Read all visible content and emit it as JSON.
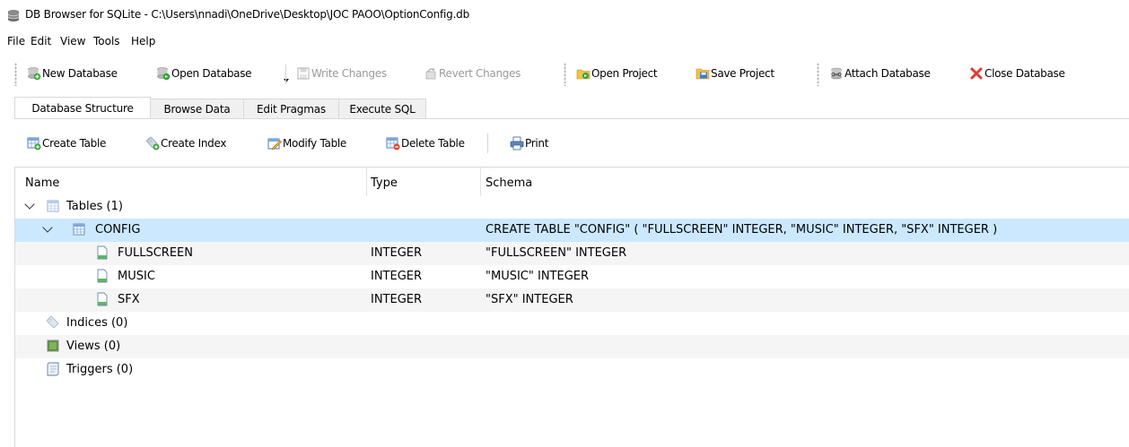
{
  "window": {
    "title": "DB Browser for SQLite - C:\\Users\\nnadi\\OneDrive\\Desktop\\JOC PAOO\\OptionConfig.db"
  },
  "menu": [
    "File",
    "Edit",
    "View",
    "Tools",
    "Help"
  ],
  "toolbar": {
    "new_database": "New Database",
    "open_database": "Open Database",
    "write_changes": "Write Changes",
    "revert_changes": "Revert Changes",
    "open_project": "Open Project",
    "save_project": "Save Project",
    "attach_database": "Attach Database",
    "close_database": "Close Database"
  },
  "tabs": [
    "Database Structure",
    "Browse Data",
    "Edit Pragmas",
    "Execute SQL"
  ],
  "active_tab": "Database Structure",
  "structure_toolbar": {
    "create_table": "Create Table",
    "create_index": "Create Index",
    "modify_table": "Modify Table",
    "delete_table": "Delete Table",
    "print": "Print"
  },
  "tree": {
    "columns": [
      "Name",
      "Type",
      "Schema"
    ],
    "rows": [
      {
        "name": "Tables (1)",
        "type": "",
        "schema": "",
        "icon": "tables-icon",
        "expanded": true
      },
      {
        "name": "CONFIG",
        "type": "",
        "schema": "CREATE TABLE \"CONFIG\" ( \"FULLSCREEN\" INTEGER, \"MUSIC\" INTEGER, \"SFX\" INTEGER )",
        "icon": "table-icon",
        "expanded": true,
        "selected": true
      },
      {
        "name": "FULLSCREEN",
        "type": "INTEGER",
        "schema": "\"FULLSCREEN\" INTEGER",
        "icon": "field-icon"
      },
      {
        "name": "MUSIC",
        "type": "INTEGER",
        "schema": "\"MUSIC\" INTEGER",
        "icon": "field-icon"
      },
      {
        "name": "SFX",
        "type": "INTEGER",
        "schema": "\"SFX\" INTEGER",
        "icon": "field-icon"
      },
      {
        "name": "Indices (0)",
        "type": "",
        "schema": "",
        "icon": "index-icon"
      },
      {
        "name": "Views (0)",
        "type": "",
        "schema": "",
        "icon": "view-icon"
      },
      {
        "name": "Triggers (0)",
        "type": "",
        "schema": "",
        "icon": "trigger-icon"
      }
    ]
  },
  "colors": {
    "selection": "#cce8ff",
    "alt_row": "#f5f5f5",
    "disabled_text": "#9a9a9a",
    "close_x": "#e23b2e",
    "add_badge": "#3aa33a"
  }
}
